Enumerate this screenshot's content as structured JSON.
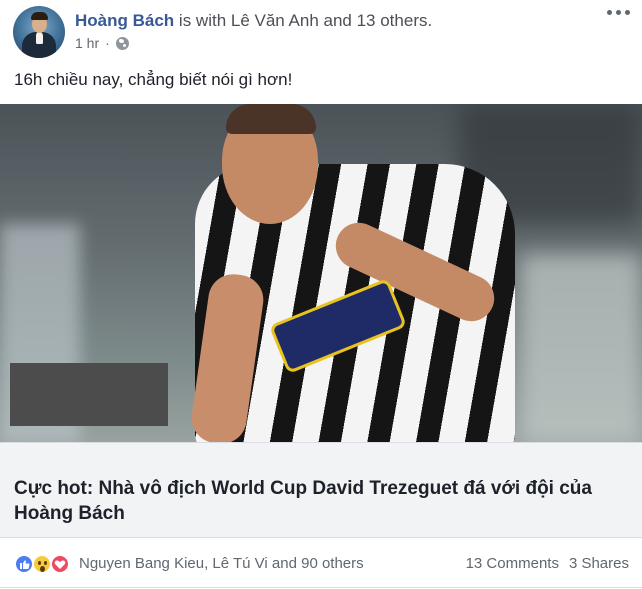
{
  "post": {
    "author": "Hoàng Bách",
    "with_text": " is with ",
    "tagged": "Lê Văn Anh and 13 others.",
    "timestamp": "1 hr",
    "privacy_icon": "globe-icon",
    "status": "16h chiều nay, chẳng biết nói gì hơn!"
  },
  "link_card": {
    "title": "Cực hot: Nhà vô địch World Cup David Trezeguet đá với đội của Hoàng Bách"
  },
  "footer": {
    "reaction_icons": [
      "like-icon",
      "wow-icon",
      "love-icon"
    ],
    "reactors": "Nguyen Bang Kieu, Lê Tú Vi and 90 others",
    "comments": "13 Comments",
    "shares": "3 Shares"
  },
  "colors": {
    "author_link": "#385898",
    "like": "#4a7df0",
    "wow": "#f7c93f",
    "love": "#ef4a5f",
    "card_bg": "#f2f3f5"
  }
}
